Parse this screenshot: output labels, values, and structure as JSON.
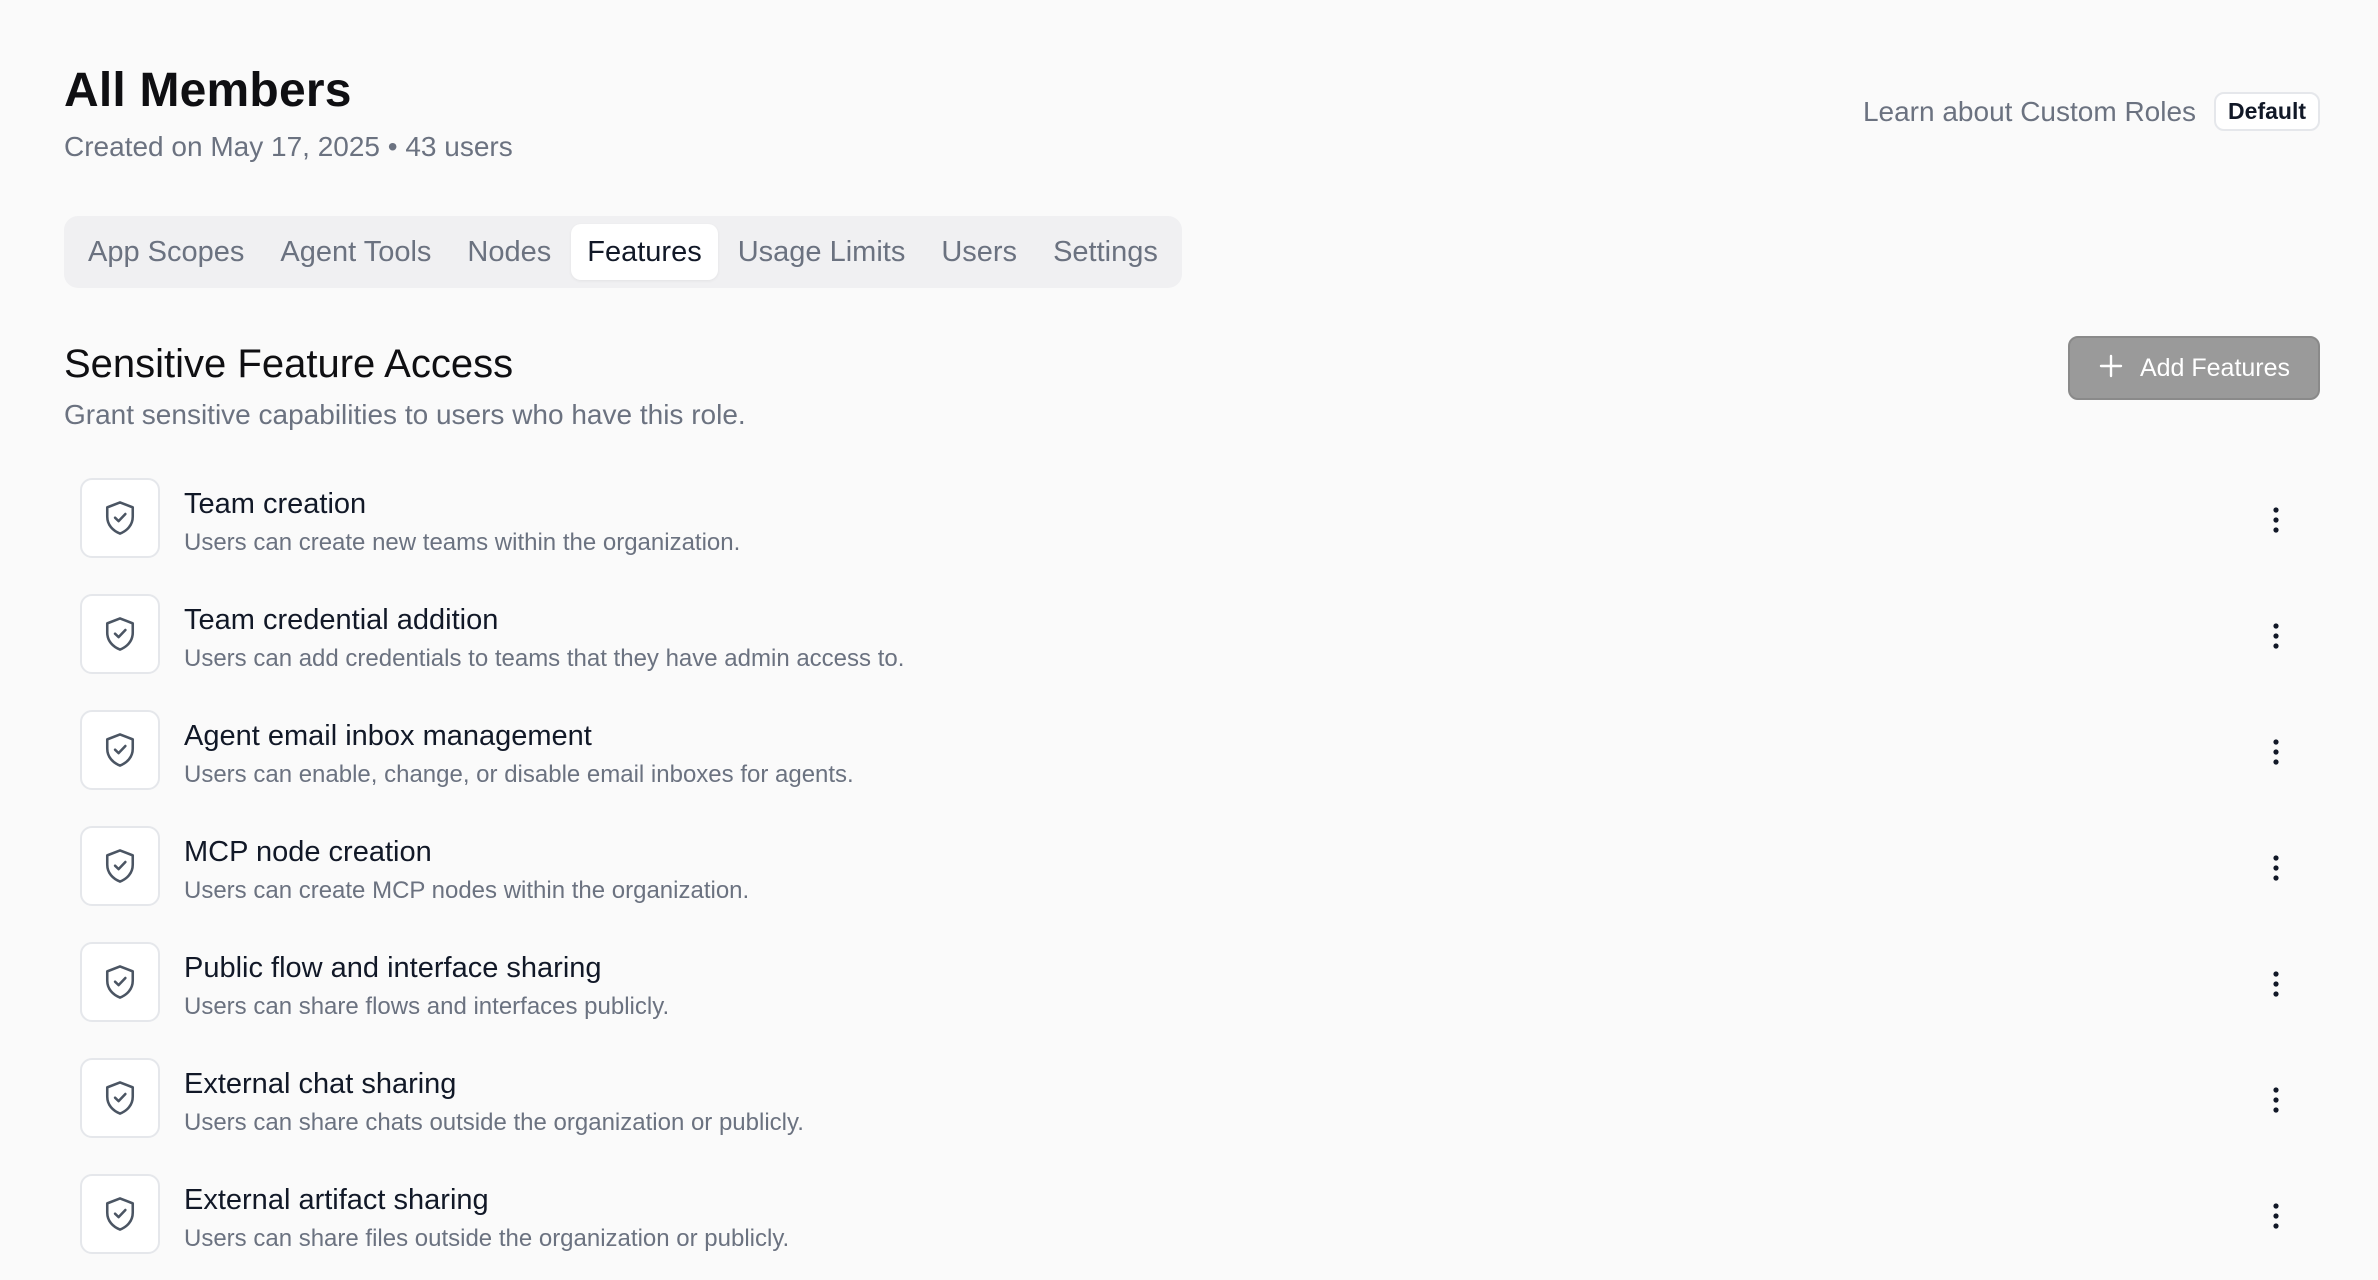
{
  "header": {
    "title": "All Members",
    "subtitle": "Created on May 17, 2025 • 43 users",
    "learn_link": "Learn about Custom Roles",
    "badge": "Default"
  },
  "tabs": [
    {
      "label": "App Scopes",
      "active": false
    },
    {
      "label": "Agent Tools",
      "active": false
    },
    {
      "label": "Nodes",
      "active": false
    },
    {
      "label": "Features",
      "active": true
    },
    {
      "label": "Usage Limits",
      "active": false
    },
    {
      "label": "Users",
      "active": false
    },
    {
      "label": "Settings",
      "active": false
    }
  ],
  "section": {
    "title": "Sensitive Feature Access",
    "description": "Grant sensitive capabilities to users who have this role.",
    "add_button_label": "Add Features",
    "add_button_icon": "plus-icon"
  },
  "features": [
    {
      "title": "Team creation",
      "description": "Users can create new teams within the organization.",
      "icon": "shield-check-icon"
    },
    {
      "title": "Team credential addition",
      "description": "Users can add credentials to teams that they have admin access to.",
      "icon": "shield-check-icon"
    },
    {
      "title": "Agent email inbox management",
      "description": "Users can enable, change, or disable email inboxes for agents.",
      "icon": "shield-check-icon"
    },
    {
      "title": "MCP node creation",
      "description": "Users can create MCP nodes within the organization.",
      "icon": "shield-check-icon"
    },
    {
      "title": "Public flow and interface sharing",
      "description": "Users can share flows and interfaces publicly.",
      "icon": "shield-check-icon"
    },
    {
      "title": "External chat sharing",
      "description": "Users can share chats outside the organization or publicly.",
      "icon": "shield-check-icon"
    },
    {
      "title": "External artifact sharing",
      "description": "Users can share files outside the organization or publicly.",
      "icon": "shield-check-icon"
    }
  ],
  "colors": {
    "background": "#fafafa",
    "muted_text": "#6b7280",
    "primary_text": "#111827",
    "button_bg": "#9a9a9a"
  }
}
